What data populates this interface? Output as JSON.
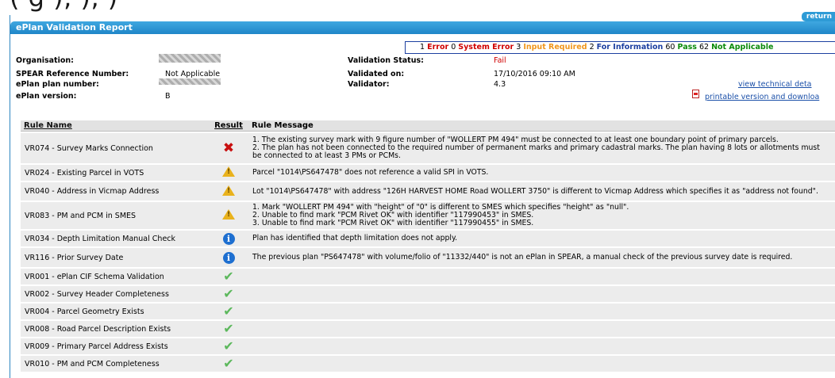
{
  "top_fragment": "( g        ),            ),              )",
  "header": {
    "return_label": "return",
    "title": "ePlan Validation Report"
  },
  "summary": {
    "errors": "1",
    "errors_label": "Error",
    "system_errors": "0",
    "system_errors_label": "System Error",
    "input_required": "3",
    "input_required_label": "Input Required",
    "for_information": "2",
    "for_information_label": "For Information",
    "pass": "60",
    "pass_label": "Pass",
    "not_applicable": "62",
    "not_applicable_label": "Not Applicable"
  },
  "meta": {
    "organisation_label": "Organisation:",
    "spear_label": "SPEAR Reference Number:",
    "spear_value": "Not Applicable",
    "plan_number_label": "ePlan plan number:",
    "version_label": "ePlan version:",
    "version_value": "B",
    "status_label": "Validation Status:",
    "status_value": "Fail",
    "validated_on_label": "Validated on:",
    "validated_on_value": "17/10/2016 09:10 AM",
    "validator_label": "Validator:",
    "validator_value": "4.3",
    "technical_link": "view technical deta",
    "printable_link": "printable version and downloa"
  },
  "table": {
    "headers": {
      "rule_name": "Rule Name",
      "result": "Result",
      "message": "Rule Message"
    },
    "rows": [
      {
        "name": "VR074 - Survey Marks Connection",
        "result": "error",
        "message": "1. The existing survey mark with 9 figure number of \"WOLLERT PM 494\" must be connected to at least one boundary point of primary parcels.\n2. The plan has not been connected to the required number of permanent marks and primary cadastral marks. The plan having 8 lots or allotments must be connected to at least 3 PMs or PCMs."
      },
      {
        "name": "VR024 - Existing Parcel in VOTS",
        "result": "warning",
        "message": "Parcel \"1014\\PS647478\" does not reference a valid SPI in VOTS."
      },
      {
        "name": "VR040 - Address in Vicmap Address",
        "result": "warning",
        "message": "Lot \"1014\\PS647478\" with address \"126H HARVEST HOME Road WOLLERT 3750\" is different to Vicmap Address which specifies it as \"address not found\"."
      },
      {
        "name": "VR083 - PM and PCM in SMES",
        "result": "warning",
        "message": "1. Mark \"WOLLERT PM 494\" with \"height\" of \"0\" is different to SMES which specifies \"height\" as \"null\".\n2. Unable to find mark \"PCM Rivet OK\" with identifier \"117990453\" in SMES.\n3. Unable to find mark \"PCM Rivet OK\" with identifier \"117990455\" in SMES."
      },
      {
        "name": "VR034 - Depth Limitation Manual Check",
        "result": "info",
        "message": "Plan has identified that depth limitation does not apply."
      },
      {
        "name": "VR116 - Prior Survey Date",
        "result": "info",
        "message": "The previous plan \"PS647478\" with volume/folio of \"11332/440\" is not an ePlan in SPEAR, a manual check of the previous survey date is required."
      },
      {
        "name": "VR001 - ePlan CIF Schema Validation",
        "result": "pass",
        "message": ""
      },
      {
        "name": "VR002 - Survey Header Completeness",
        "result": "pass",
        "message": ""
      },
      {
        "name": "VR004 - Parcel Geometry Exists",
        "result": "pass",
        "message": ""
      },
      {
        "name": "VR008 - Road Parcel Description Exists",
        "result": "pass",
        "message": ""
      },
      {
        "name": "VR009 - Primary Parcel Address Exists",
        "result": "pass",
        "message": ""
      },
      {
        "name": "VR010 - PM and PCM Completeness",
        "result": "pass",
        "message": ""
      }
    ]
  },
  "colors": {
    "title_bar": "#1f86c8",
    "error": "#c81010",
    "input_required": "#f0961c",
    "information": "#1c3fa0",
    "pass": "#0a8a0a"
  }
}
